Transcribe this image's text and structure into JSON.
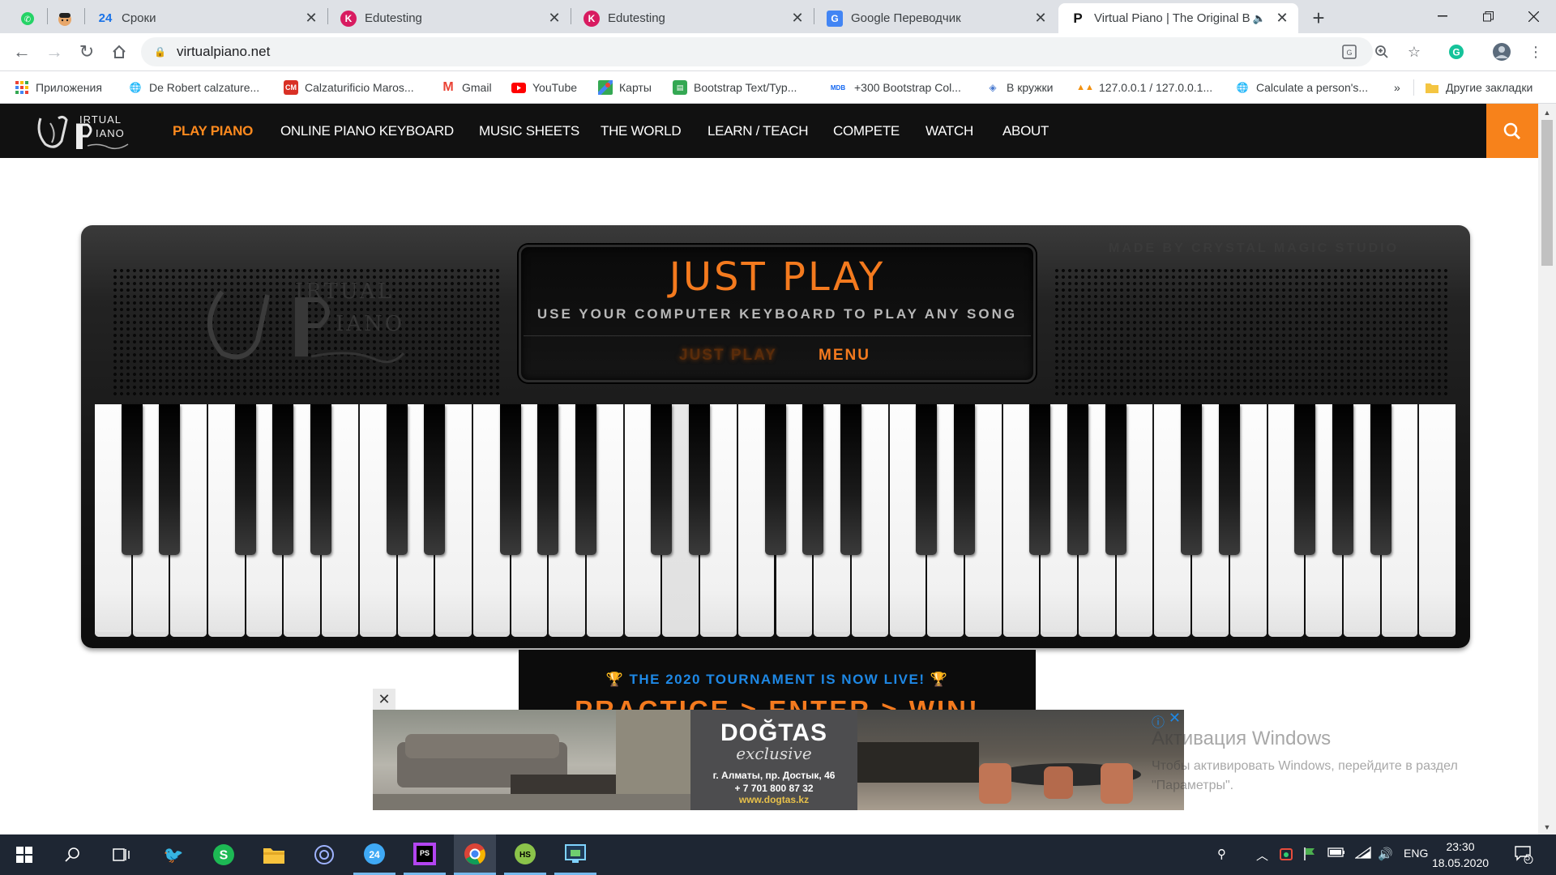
{
  "browser": {
    "pinned_tabs": [
      {
        "icon": "whatsapp-icon",
        "color": "#25d366"
      },
      {
        "icon": "avatar-icon",
        "color": "#e06b3b"
      }
    ],
    "tabs": [
      {
        "title": "Сроки",
        "favicon_text": "24",
        "favicon_color": "#1a73e8"
      },
      {
        "title": "Edutesting",
        "favicon_text": "K",
        "favicon_color": "#d81b60"
      },
      {
        "title": "Edutesting",
        "favicon_text": "K",
        "favicon_color": "#d81b60"
      },
      {
        "title": "Google Переводчик",
        "favicon_text": "G",
        "favicon_color": "#4285f4"
      },
      {
        "title": "Virtual Piano | The Original B",
        "favicon_text": "P",
        "favicon_color": "#111111",
        "active": true
      }
    ],
    "new_tab": "+",
    "url": "virtualpiano.net"
  },
  "bookmarks": [
    {
      "label": "Приложения",
      "icon": "apps-grid-icon",
      "color": "#ea4335"
    },
    {
      "label": "De Robert calzature...",
      "icon": "globe-icon",
      "color": "#5f6368"
    },
    {
      "label": "Calzaturificio Maros...",
      "icon": "site-icon",
      "color": "#d93025"
    },
    {
      "label": "Gmail",
      "icon": "gmail-icon",
      "color": "#ea4335"
    },
    {
      "label": "YouTube",
      "icon": "youtube-icon",
      "color": "#ff0000"
    },
    {
      "label": "Карты",
      "icon": "maps-icon",
      "color": "#34a853"
    },
    {
      "label": "Bootstrap Text/Typ...",
      "icon": "bootstrap-icon",
      "color": "#34a853"
    },
    {
      "label": "+300 Bootstrap Col...",
      "icon": "mdb-icon",
      "color": "#1266f1"
    },
    {
      "label": "В кружки",
      "icon": "puzzle-icon",
      "color": "#4a7bd0"
    },
    {
      "label": "127.0.0.1 / 127.0.0.1...",
      "icon": "phpmyadmin-icon",
      "color": "#f29111"
    },
    {
      "label": "Calculate a person's...",
      "icon": "globe-icon",
      "color": "#5f6368"
    },
    {
      "label": "»",
      "icon": "overflow-icon",
      "color": "#5f6368"
    },
    {
      "label": "Другие закладки",
      "icon": "folder-icon",
      "color": "#f4c542"
    }
  ],
  "site": {
    "nav": [
      {
        "label": "PLAY PIANO",
        "active": true
      },
      {
        "label": "ONLINE PIANO KEYBOARD"
      },
      {
        "label": "MUSIC SHEETS"
      },
      {
        "label": "THE WORLD"
      },
      {
        "label": "LEARN / TEACH"
      },
      {
        "label": "COMPETE"
      },
      {
        "label": "WATCH"
      },
      {
        "label": "ABOUT"
      }
    ],
    "logo_text": [
      "IRTUAL",
      "IANO"
    ],
    "accent": "#f7821b"
  },
  "piano": {
    "studio": "MADE BY CRYSTAL MAGIC STUDIO",
    "title": "JUST PLAY",
    "subtitle": "USE YOUR COMPUTER KEYBOARD TO PLAY ANY SONG",
    "mode_current": "JUST PLAY",
    "mode_menu": "MENU",
    "white_key_count": 36,
    "pressed_white_key_index": 15
  },
  "tournament": {
    "headline": "THE 2020 TOURNAMENT IS NOW LIVE!",
    "cta": "PRACTICE > ENTER > WIN!"
  },
  "ad": {
    "brand": "DOĞTAS",
    "tagline": "exclusive",
    "address": "г. Алматы, пр. Достык, 46",
    "phone": "+ 7 701 800 87 32",
    "website": "www.dogtas.kz"
  },
  "windows_activation": {
    "title": "Активация Windows",
    "line1": "Чтобы активировать Windows, перейдите в раздел",
    "line2": "\"Параметры\"."
  },
  "taskbar": {
    "language": "ENG",
    "time": "23:30",
    "date": "18.05.2020",
    "notifications": "5"
  }
}
